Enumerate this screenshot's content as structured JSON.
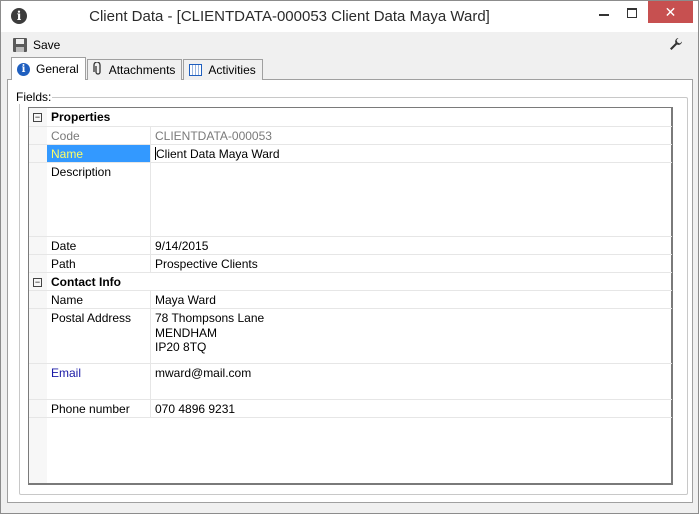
{
  "window": {
    "title": "Client Data - [CLIENTDATA-000053 Client Data Maya Ward]",
    "icon": "info-icon",
    "buttons": {
      "minimize": "minimize",
      "maximize": "maximize",
      "close": "✕"
    }
  },
  "toolbar": {
    "save_label": "Save",
    "settings_icon": "wrench-icon"
  },
  "tabs": [
    {
      "label": "General",
      "icon": "info-icon",
      "active": true
    },
    {
      "label": "Attachments",
      "icon": "paperclip-icon",
      "active": false
    },
    {
      "label": "Activities",
      "icon": "calendar-icon",
      "active": false
    }
  ],
  "fields_label": "Fields:",
  "properties": {
    "category": "Properties",
    "code_label": "Code",
    "code_value": "CLIENTDATA-000053",
    "name_label": "Name",
    "name_value": "Client Data Maya Ward",
    "description_label": "Description",
    "description_value": "",
    "date_label": "Date",
    "date_value": "9/14/2015",
    "path_label": "Path",
    "path_value": "Prospective Clients"
  },
  "contact_info": {
    "category": "Contact Info",
    "name_label": "Name",
    "name_value": "Maya Ward",
    "postal_label": "Postal Address",
    "postal_lines": [
      "78 Thompsons Lane",
      "MENDHAM",
      "IP20 8TQ"
    ],
    "email_label": "Email",
    "email_value": "mward@mail.com",
    "phone_label": "Phone number",
    "phone_value": "070 4896 9231"
  },
  "colors": {
    "selection": "#3399ff",
    "selection_text": "#ffff66",
    "close_button": "#c75050",
    "email_label": "#1a1aa6"
  }
}
